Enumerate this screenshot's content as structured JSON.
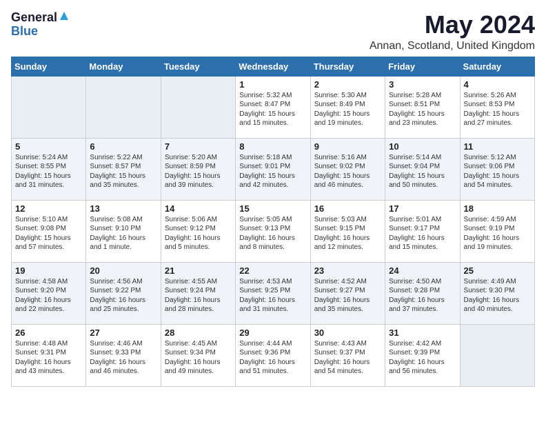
{
  "logo": {
    "general": "General",
    "blue": "Blue"
  },
  "title": {
    "month_year": "May 2024",
    "location": "Annan, Scotland, United Kingdom"
  },
  "days_header": [
    "Sunday",
    "Monday",
    "Tuesday",
    "Wednesday",
    "Thursday",
    "Friday",
    "Saturday"
  ],
  "weeks": [
    [
      {
        "day": "",
        "text": ""
      },
      {
        "day": "",
        "text": ""
      },
      {
        "day": "",
        "text": ""
      },
      {
        "day": "1",
        "text": "Sunrise: 5:32 AM\nSunset: 8:47 PM\nDaylight: 15 hours\nand 15 minutes."
      },
      {
        "day": "2",
        "text": "Sunrise: 5:30 AM\nSunset: 8:49 PM\nDaylight: 15 hours\nand 19 minutes."
      },
      {
        "day": "3",
        "text": "Sunrise: 5:28 AM\nSunset: 8:51 PM\nDaylight: 15 hours\nand 23 minutes."
      },
      {
        "day": "4",
        "text": "Sunrise: 5:26 AM\nSunset: 8:53 PM\nDaylight: 15 hours\nand 27 minutes."
      }
    ],
    [
      {
        "day": "5",
        "text": "Sunrise: 5:24 AM\nSunset: 8:55 PM\nDaylight: 15 hours\nand 31 minutes."
      },
      {
        "day": "6",
        "text": "Sunrise: 5:22 AM\nSunset: 8:57 PM\nDaylight: 15 hours\nand 35 minutes."
      },
      {
        "day": "7",
        "text": "Sunrise: 5:20 AM\nSunset: 8:59 PM\nDaylight: 15 hours\nand 39 minutes."
      },
      {
        "day": "8",
        "text": "Sunrise: 5:18 AM\nSunset: 9:01 PM\nDaylight: 15 hours\nand 42 minutes."
      },
      {
        "day": "9",
        "text": "Sunrise: 5:16 AM\nSunset: 9:02 PM\nDaylight: 15 hours\nand 46 minutes."
      },
      {
        "day": "10",
        "text": "Sunrise: 5:14 AM\nSunset: 9:04 PM\nDaylight: 15 hours\nand 50 minutes."
      },
      {
        "day": "11",
        "text": "Sunrise: 5:12 AM\nSunset: 9:06 PM\nDaylight: 15 hours\nand 54 minutes."
      }
    ],
    [
      {
        "day": "12",
        "text": "Sunrise: 5:10 AM\nSunset: 9:08 PM\nDaylight: 15 hours\nand 57 minutes."
      },
      {
        "day": "13",
        "text": "Sunrise: 5:08 AM\nSunset: 9:10 PM\nDaylight: 16 hours\nand 1 minute."
      },
      {
        "day": "14",
        "text": "Sunrise: 5:06 AM\nSunset: 9:12 PM\nDaylight: 16 hours\nand 5 minutes."
      },
      {
        "day": "15",
        "text": "Sunrise: 5:05 AM\nSunset: 9:13 PM\nDaylight: 16 hours\nand 8 minutes."
      },
      {
        "day": "16",
        "text": "Sunrise: 5:03 AM\nSunset: 9:15 PM\nDaylight: 16 hours\nand 12 minutes."
      },
      {
        "day": "17",
        "text": "Sunrise: 5:01 AM\nSunset: 9:17 PM\nDaylight: 16 hours\nand 15 minutes."
      },
      {
        "day": "18",
        "text": "Sunrise: 4:59 AM\nSunset: 9:19 PM\nDaylight: 16 hours\nand 19 minutes."
      }
    ],
    [
      {
        "day": "19",
        "text": "Sunrise: 4:58 AM\nSunset: 9:20 PM\nDaylight: 16 hours\nand 22 minutes."
      },
      {
        "day": "20",
        "text": "Sunrise: 4:56 AM\nSunset: 9:22 PM\nDaylight: 16 hours\nand 25 minutes."
      },
      {
        "day": "21",
        "text": "Sunrise: 4:55 AM\nSunset: 9:24 PM\nDaylight: 16 hours\nand 28 minutes."
      },
      {
        "day": "22",
        "text": "Sunrise: 4:53 AM\nSunset: 9:25 PM\nDaylight: 16 hours\nand 31 minutes."
      },
      {
        "day": "23",
        "text": "Sunrise: 4:52 AM\nSunset: 9:27 PM\nDaylight: 16 hours\nand 35 minutes."
      },
      {
        "day": "24",
        "text": "Sunrise: 4:50 AM\nSunset: 9:28 PM\nDaylight: 16 hours\nand 37 minutes."
      },
      {
        "day": "25",
        "text": "Sunrise: 4:49 AM\nSunset: 9:30 PM\nDaylight: 16 hours\nand 40 minutes."
      }
    ],
    [
      {
        "day": "26",
        "text": "Sunrise: 4:48 AM\nSunset: 9:31 PM\nDaylight: 16 hours\nand 43 minutes."
      },
      {
        "day": "27",
        "text": "Sunrise: 4:46 AM\nSunset: 9:33 PM\nDaylight: 16 hours\nand 46 minutes."
      },
      {
        "day": "28",
        "text": "Sunrise: 4:45 AM\nSunset: 9:34 PM\nDaylight: 16 hours\nand 49 minutes."
      },
      {
        "day": "29",
        "text": "Sunrise: 4:44 AM\nSunset: 9:36 PM\nDaylight: 16 hours\nand 51 minutes."
      },
      {
        "day": "30",
        "text": "Sunrise: 4:43 AM\nSunset: 9:37 PM\nDaylight: 16 hours\nand 54 minutes."
      },
      {
        "day": "31",
        "text": "Sunrise: 4:42 AM\nSunset: 9:39 PM\nDaylight: 16 hours\nand 56 minutes."
      },
      {
        "day": "",
        "text": ""
      }
    ]
  ]
}
